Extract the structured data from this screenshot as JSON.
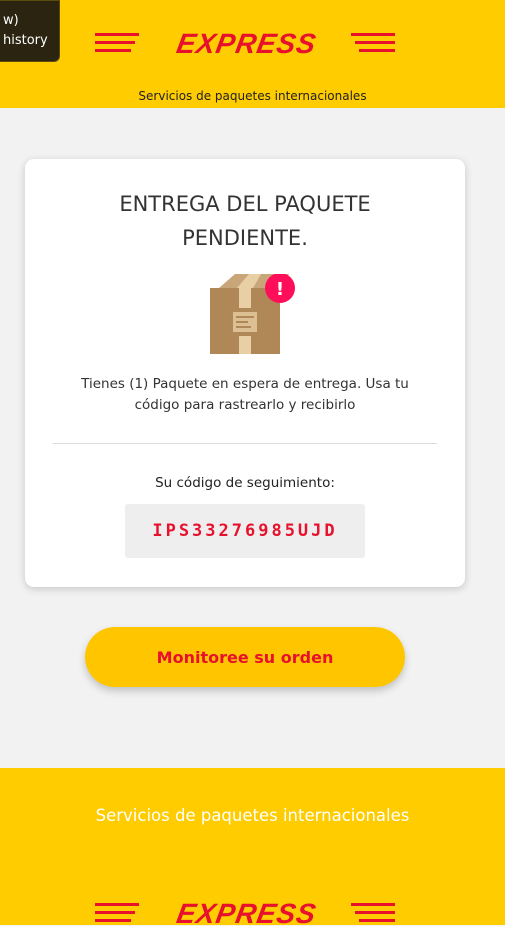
{
  "history_chip": {
    "line1": "w)",
    "line2": "history"
  },
  "header": {
    "logo_text": "EXPRESS",
    "subtitle": "Servicios de paquetes internacionales"
  },
  "card": {
    "title_line1": "ENTREGA DEL PAQUETE",
    "title_line2": "PENDIENTE.",
    "alert_mark": "!",
    "message": "Tienes (1) Paquete en espera de entrega. Usa tu código para rastrearlo y recibirlo",
    "tracking_label": "Su código de seguimiento:",
    "tracking_code": "IPS33276985UJD"
  },
  "cta": {
    "label": "Monitoree su orden"
  },
  "footer": {
    "text": "Servicios de paquetes internacionales",
    "logo_text": "EXPRESS"
  },
  "colors": {
    "brand_yellow": "#ffcc00",
    "brand_red": "#e8112d",
    "alert_pink": "#ff0f5a"
  }
}
